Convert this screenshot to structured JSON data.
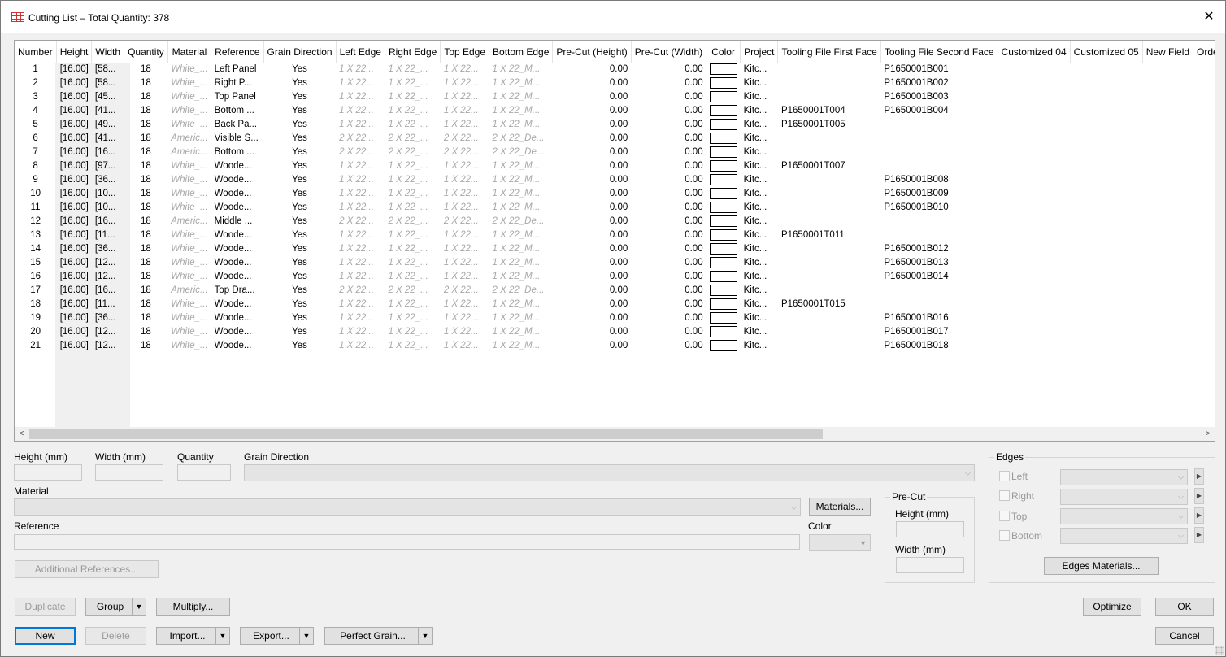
{
  "window": {
    "title": "Cutting List – Total Quantity: 378",
    "close_glyph": "✕",
    "icon": "table-icon"
  },
  "grid": {
    "columns": [
      "Number",
      "Height",
      "Width",
      "Quantity",
      "Material",
      "Reference",
      "Grain Direction",
      "Left Edge",
      "Right Edge",
      "Top Edge",
      "Bottom Edge",
      "Pre-Cut (Height)",
      "Pre-Cut (Width)",
      "Color",
      "Project",
      "Tooling File First Face",
      "Tooling File Second Face",
      "Customized 04",
      "Customized 05",
      "New Field",
      "Order Name"
    ],
    "rows": [
      [
        "1",
        "[16.00]",
        "[58...",
        "18",
        "White_...",
        "Left Panel",
        "Yes",
        "1 X 22...",
        "1 X 22_...",
        "1 X 22...",
        "1 X 22_M...",
        "0.00",
        "0.00",
        "",
        "Kitc...",
        "",
        "P1650001B001"
      ],
      [
        "2",
        "[16.00]",
        "[58...",
        "18",
        "White_...",
        "Right P...",
        "Yes",
        "1 X 22...",
        "1 X 22_...",
        "1 X 22...",
        "1 X 22_M...",
        "0.00",
        "0.00",
        "",
        "Kitc...",
        "",
        "P1650001B002"
      ],
      [
        "3",
        "[16.00]",
        "[45...",
        "18",
        "White_...",
        "Top Panel",
        "Yes",
        "1 X 22...",
        "1 X 22_...",
        "1 X 22...",
        "1 X 22_M...",
        "0.00",
        "0.00",
        "",
        "Kitc...",
        "",
        "P1650001B003"
      ],
      [
        "4",
        "[16.00]",
        "[41...",
        "18",
        "White_...",
        "Bottom ...",
        "Yes",
        "1 X 22...",
        "1 X 22_...",
        "1 X 22...",
        "1 X 22_M...",
        "0.00",
        "0.00",
        "",
        "Kitc...",
        "P1650001T004",
        "P1650001B004"
      ],
      [
        "5",
        "[16.00]",
        "[49...",
        "18",
        "White_...",
        "Back Pa...",
        "Yes",
        "1 X 22...",
        "1 X 22_...",
        "1 X 22...",
        "1 X 22_M...",
        "0.00",
        "0.00",
        "",
        "Kitc...",
        "P1650001T005",
        ""
      ],
      [
        "6",
        "[16.00]",
        "[41...",
        "18",
        "Americ...",
        "Visible S...",
        "Yes",
        "2 X 22...",
        "2 X 22_...",
        "2 X 22...",
        "2 X 22_De...",
        "0.00",
        "0.00",
        "",
        "Kitc...",
        "",
        ""
      ],
      [
        "7",
        "[16.00]",
        "[16...",
        "18",
        "Americ...",
        "Bottom ...",
        "Yes",
        "2 X 22...",
        "2 X 22_...",
        "2 X 22...",
        "2 X 22_De...",
        "0.00",
        "0.00",
        "",
        "Kitc...",
        "",
        ""
      ],
      [
        "8",
        "[16.00]",
        "[97...",
        "18",
        "White_...",
        "Woode...",
        "Yes",
        "1 X 22...",
        "1 X 22_...",
        "1 X 22...",
        "1 X 22_M...",
        "0.00",
        "0.00",
        "",
        "Kitc...",
        "P1650001T007",
        ""
      ],
      [
        "9",
        "[16.00]",
        "[36...",
        "18",
        "White_...",
        "Woode...",
        "Yes",
        "1 X 22...",
        "1 X 22_...",
        "1 X 22...",
        "1 X 22_M...",
        "0.00",
        "0.00",
        "",
        "Kitc...",
        "",
        "P1650001B008"
      ],
      [
        "10",
        "[16.00]",
        "[10...",
        "18",
        "White_...",
        "Woode...",
        "Yes",
        "1 X 22...",
        "1 X 22_...",
        "1 X 22...",
        "1 X 22_M...",
        "0.00",
        "0.00",
        "",
        "Kitc...",
        "",
        "P1650001B009"
      ],
      [
        "11",
        "[16.00]",
        "[10...",
        "18",
        "White_...",
        "Woode...",
        "Yes",
        "1 X 22...",
        "1 X 22_...",
        "1 X 22...",
        "1 X 22_M...",
        "0.00",
        "0.00",
        "",
        "Kitc...",
        "",
        "P1650001B010"
      ],
      [
        "12",
        "[16.00]",
        "[16...",
        "18",
        "Americ...",
        "Middle ...",
        "Yes",
        "2 X 22...",
        "2 X 22_...",
        "2 X 22...",
        "2 X 22_De...",
        "0.00",
        "0.00",
        "",
        "Kitc...",
        "",
        ""
      ],
      [
        "13",
        "[16.00]",
        "[11...",
        "18",
        "White_...",
        "Woode...",
        "Yes",
        "1 X 22...",
        "1 X 22_...",
        "1 X 22...",
        "1 X 22_M...",
        "0.00",
        "0.00",
        "",
        "Kitc...",
        "P1650001T011",
        ""
      ],
      [
        "14",
        "[16.00]",
        "[36...",
        "18",
        "White_...",
        "Woode...",
        "Yes",
        "1 X 22...",
        "1 X 22_...",
        "1 X 22...",
        "1 X 22_M...",
        "0.00",
        "0.00",
        "",
        "Kitc...",
        "",
        "P1650001B012"
      ],
      [
        "15",
        "[16.00]",
        "[12...",
        "18",
        "White_...",
        "Woode...",
        "Yes",
        "1 X 22...",
        "1 X 22_...",
        "1 X 22...",
        "1 X 22_M...",
        "0.00",
        "0.00",
        "",
        "Kitc...",
        "",
        "P1650001B013"
      ],
      [
        "16",
        "[16.00]",
        "[12...",
        "18",
        "White_...",
        "Woode...",
        "Yes",
        "1 X 22...",
        "1 X 22_...",
        "1 X 22...",
        "1 X 22_M...",
        "0.00",
        "0.00",
        "",
        "Kitc...",
        "",
        "P1650001B014"
      ],
      [
        "17",
        "[16.00]",
        "[16...",
        "18",
        "Americ...",
        "Top Dra...",
        "Yes",
        "2 X 22...",
        "2 X 22_...",
        "2 X 22...",
        "2 X 22_De...",
        "0.00",
        "0.00",
        "",
        "Kitc...",
        "",
        ""
      ],
      [
        "18",
        "[16.00]",
        "[11...",
        "18",
        "White_...",
        "Woode...",
        "Yes",
        "1 X 22...",
        "1 X 22_...",
        "1 X 22...",
        "1 X 22_M...",
        "0.00",
        "0.00",
        "",
        "Kitc...",
        "P1650001T015",
        ""
      ],
      [
        "19",
        "[16.00]",
        "[36...",
        "18",
        "White_...",
        "Woode...",
        "Yes",
        "1 X 22...",
        "1 X 22_...",
        "1 X 22...",
        "1 X 22_M...",
        "0.00",
        "0.00",
        "",
        "Kitc...",
        "",
        "P1650001B016"
      ],
      [
        "20",
        "[16.00]",
        "[12...",
        "18",
        "White_...",
        "Woode...",
        "Yes",
        "1 X 22...",
        "1 X 22_...",
        "1 X 22...",
        "1 X 22_M...",
        "0.00",
        "0.00",
        "",
        "Kitc...",
        "",
        "P1650001B017"
      ],
      [
        "21",
        "[16.00]",
        "[12...",
        "18",
        "White_...",
        "Woode...",
        "Yes",
        "1 X 22...",
        "1 X 22_...",
        "1 X 22...",
        "1 X 22_M...",
        "0.00",
        "0.00",
        "",
        "Kitc...",
        "",
        "P1650001B018"
      ]
    ],
    "scroll_left_glyph": "<",
    "scroll_right_glyph": ">"
  },
  "form": {
    "height_label": "Height (mm)",
    "width_label": "Width (mm)",
    "quantity_label": "Quantity",
    "grain_direction_label": "Grain Direction",
    "material_label": "Material",
    "reference_label": "Reference",
    "color_label": "Color",
    "materials_button": "Materials...",
    "additional_references_button": "Additional References...",
    "precut": {
      "legend": "Pre-Cut",
      "height_label": "Height (mm)",
      "width_label": "Width (mm)"
    },
    "edges": {
      "legend": "Edges",
      "left": "Left",
      "right": "Right",
      "top": "Top",
      "bottom": "Bottom",
      "materials_button": "Edges Materials..."
    }
  },
  "buttons": {
    "duplicate": "Duplicate",
    "group": "Group",
    "multiply": "Multiply...",
    "new": "New",
    "delete": "Delete",
    "import": "Import...",
    "export": "Export...",
    "perfect_grain": "Perfect Grain...",
    "optimize": "Optimize",
    "ok": "OK",
    "cancel": "Cancel"
  },
  "colors": {
    "accent": "#0078d7",
    "disabled_text": "#9a9a9a",
    "italic_cell": "#a8a8a8"
  }
}
